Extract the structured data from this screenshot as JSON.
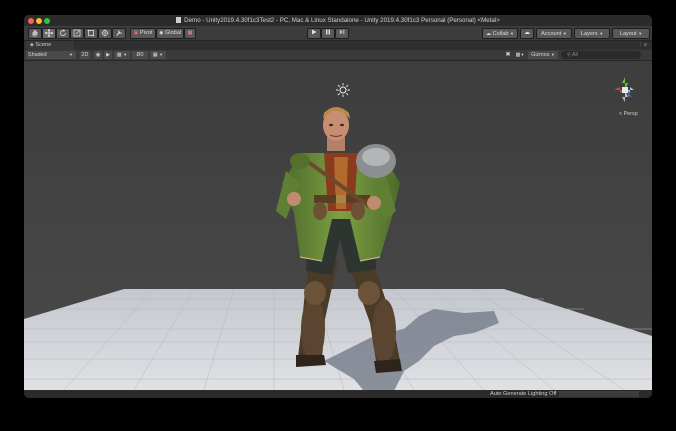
{
  "window": {
    "title": "Demo - Unity2019.4.30f1c3Test2 - PC, Mac & Linux Standalone - Unity 2019.4.30f1c3 Personal (Personal) <Metal>"
  },
  "toolbar": {
    "pivot_label": "Pivot",
    "global_label": "Global",
    "collab_label": "Collab",
    "account_label": "Account",
    "layers_label": "Layers",
    "layout_label": "Layout",
    "play_icon": "play-icon",
    "pause_icon": "pause-icon",
    "step_icon": "step-icon"
  },
  "scene": {
    "tab_label": "Scene",
    "shading_mode": "Shaded",
    "mode_2d_label": "2D",
    "hidden_count": "0",
    "gizmos_label": "Gizmos",
    "search_placeholder": "All",
    "persp_label": "< Persp"
  },
  "status": {
    "lighting_message": "Auto Generate Lighting Off"
  },
  "colors": {
    "gizmo_x": "#d24b3a",
    "gizmo_y": "#6ac238",
    "gizmo_z": "#3c7bd6"
  }
}
